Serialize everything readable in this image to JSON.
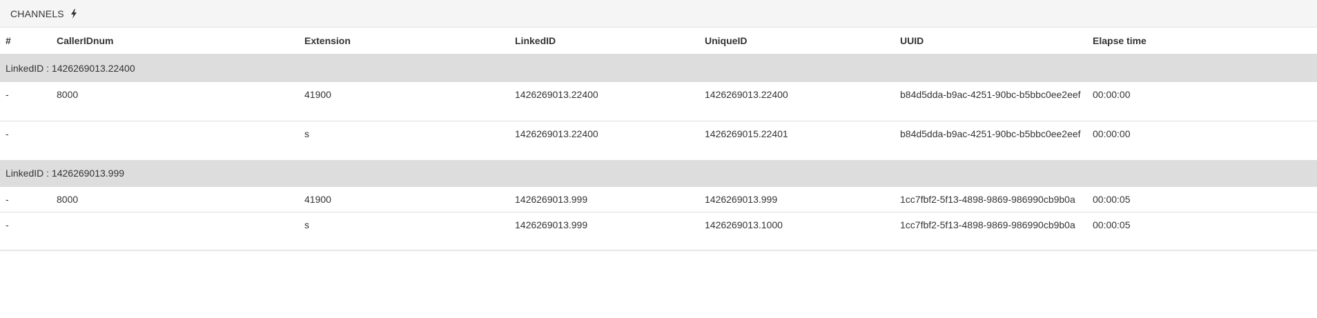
{
  "panel": {
    "title": "CHANNELS",
    "icon": "bolt-icon"
  },
  "table": {
    "headers": [
      "#",
      "CallerIDnum",
      "Extension",
      "LinkedID",
      "UniqueID",
      "UUID",
      "Elapse time"
    ],
    "groups": [
      {
        "label": "LinkedID : 1426269013.22400",
        "rows": [
          {
            "num": "-",
            "callerid": "8000",
            "extension": "41900",
            "linkedid": "1426269013.22400",
            "uniqueid": "1426269013.22400",
            "uuid": "b84d5dda-b9ac-4251-90bc-b5bbc0ee2eef",
            "elapse": "00:00:00"
          },
          {
            "num": "-",
            "callerid": "",
            "extension": "s",
            "linkedid": "1426269013.22400",
            "uniqueid": "1426269015.22401",
            "uuid": "b84d5dda-b9ac-4251-90bc-b5bbc0ee2eef",
            "elapse": "00:00:00"
          }
        ]
      },
      {
        "label": "LinkedID : 1426269013.999",
        "rows": [
          {
            "num": "-",
            "callerid": "8000",
            "extension": "41900",
            "linkedid": "1426269013.999",
            "uniqueid": "1426269013.999",
            "uuid": "1cc7fbf2-5f13-4898-9869-986990cb9b0a",
            "elapse": "00:00:05"
          },
          {
            "num": "-",
            "callerid": "",
            "extension": "s",
            "linkedid": "1426269013.999",
            "uniqueid": "1426269013.1000",
            "uuid": "1cc7fbf2-5f13-4898-9869-986990cb9b0a",
            "elapse": "00:00:05"
          }
        ]
      }
    ]
  }
}
